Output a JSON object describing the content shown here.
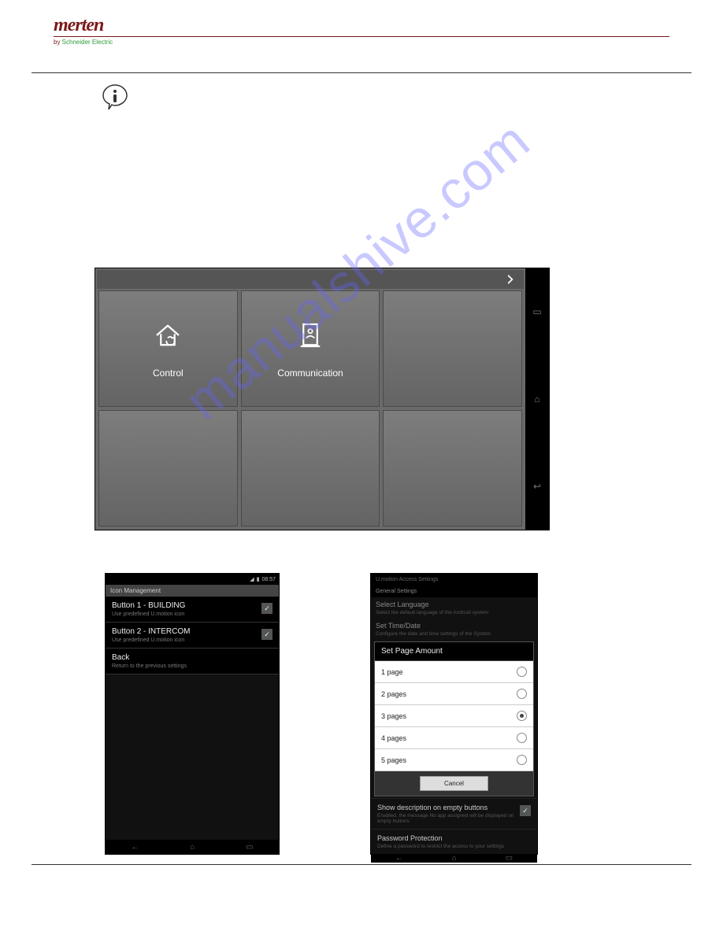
{
  "watermark": "manualshive.com",
  "logo": {
    "brand": "merten",
    "by": "by ",
    "se": "Schneider Electric"
  },
  "shot1": {
    "tiles": [
      {
        "label": "Control"
      },
      {
        "label": "Communication"
      }
    ]
  },
  "shot2": {
    "time": "08:57",
    "title": "Icon Management",
    "rows": [
      {
        "title": "Button 1 - BUILDING",
        "sub": "Use predefined U.motion icon"
      },
      {
        "title": "Button 2 - INTERCOM",
        "sub": "Use predefined U.motion icon"
      },
      {
        "title": "Back",
        "sub": "Return to the previous settings"
      }
    ]
  },
  "shot3": {
    "crumb": "U.motion Access Settings",
    "section": "General Settings",
    "dimmed": [
      {
        "title": "Select Language",
        "sub": "Select the default language of the Android system"
      },
      {
        "title": "Set Time/Date",
        "sub": "Configure the date and time settings of the System"
      }
    ],
    "dialog_title": "Set Page Amount",
    "options": [
      "1 page",
      "2 pages",
      "3 pages",
      "4 pages",
      "5 pages"
    ],
    "selected_idx": 2,
    "cancel": "Cancel",
    "below": [
      {
        "title": "Show description on empty buttons",
        "sub": "Enabled, the message No app assigned will be displayed on empty buttons"
      },
      {
        "title": "Password Protection",
        "sub": "Define a password to restrict the access to your settings"
      }
    ]
  }
}
